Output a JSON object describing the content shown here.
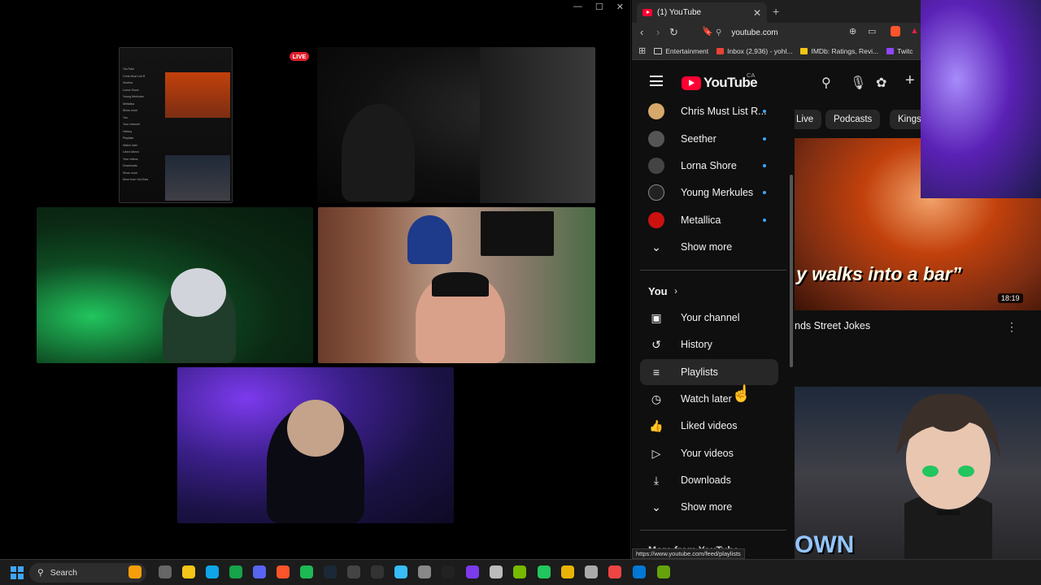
{
  "stream": {
    "live_badge": "LIVE",
    "window_controls": [
      "—",
      "☐",
      "✕"
    ],
    "mini_sidebar": [
      "YouTube",
      "Chris Must List R",
      "Seether",
      "Lorna Shore",
      "Young Merkules",
      "Metallica",
      "Show more",
      "You",
      "Your channel",
      "History",
      "Playlists",
      "Watch later",
      "Liked videos",
      "Your videos",
      "Downloads",
      "Show more",
      "More from YouTube"
    ]
  },
  "browser": {
    "tab_title": "(1) YouTube",
    "tab_close": "✕",
    "new_tab": "+",
    "url": "youtube.com",
    "bookmarks": [
      {
        "label": "Entertainment",
        "icon": "folder-icon"
      },
      {
        "label": "Inbox (2,936) - yohl...",
        "icon": "gmail-icon",
        "color": "#ea4335"
      },
      {
        "label": "IMDb: Ratings, Revi...",
        "icon": "imdb-icon",
        "color": "#f5c518"
      },
      {
        "label": "Twitc",
        "icon": "twitch-icon",
        "color": "#9146ff"
      }
    ],
    "status_url": "https://www.youtube.com/feed/playlists"
  },
  "youtube": {
    "wordmark": "YouTube",
    "country": "CA",
    "subscriptions": [
      {
        "label": "Chris Must List R...",
        "color": "#d6a86a"
      },
      {
        "label": "Seether",
        "color": "#555555"
      },
      {
        "label": "Lorna Shore",
        "color": "#444444"
      },
      {
        "label": "Young Merkules",
        "color": "#222222"
      },
      {
        "label": "Metallica",
        "color": "#cc1111"
      }
    ],
    "show_more_1": "Show more",
    "you_heading": "You",
    "you_items": [
      {
        "label": "Your channel",
        "icon": "person-icon"
      },
      {
        "label": "History",
        "icon": "history-icon"
      },
      {
        "label": "Playlists",
        "icon": "playlists-icon"
      },
      {
        "label": "Watch later",
        "icon": "clock-icon"
      },
      {
        "label": "Liked videos",
        "icon": "thumbs-up-icon"
      },
      {
        "label": "Your videos",
        "icon": "video-icon"
      },
      {
        "label": "Downloads",
        "icon": "download-icon"
      }
    ],
    "show_more_2": "Show more",
    "more_from": "More from YouTube",
    "chips": [
      "Live",
      "Podcasts",
      "Kings"
    ],
    "video1": {
      "thumb_text": "y walks into a bar”",
      "duration": "18:19",
      "title": "nds Street Jokes"
    },
    "video2": {
      "thumb_text": "OWN"
    }
  },
  "taskbar": {
    "search_label": "Search"
  }
}
